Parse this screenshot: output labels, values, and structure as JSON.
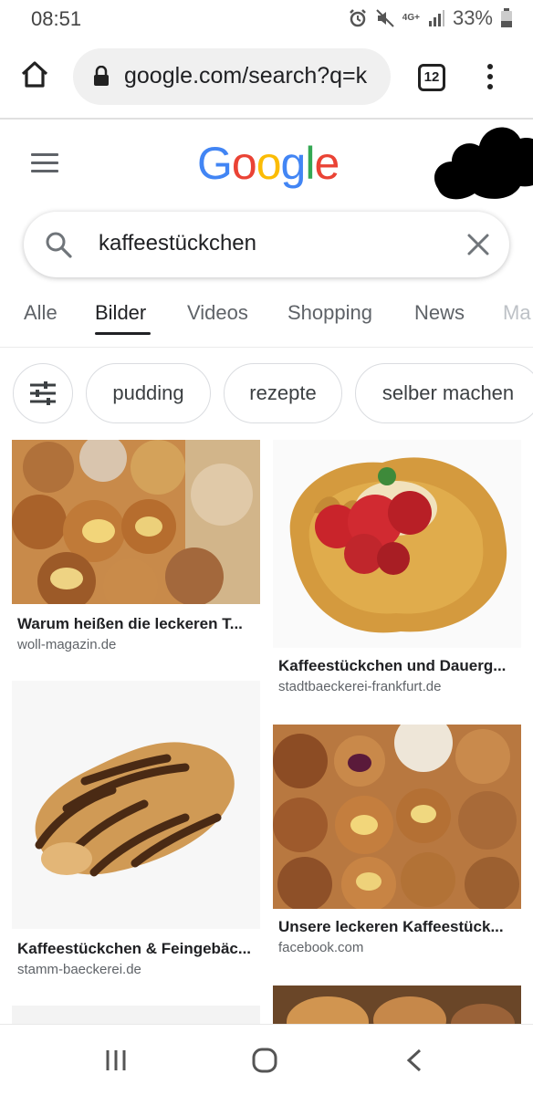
{
  "status_bar": {
    "time": "08:51",
    "network": "4G+",
    "battery": "33%"
  },
  "browser": {
    "url": "google.com/search?q=k",
    "tab_count": "12"
  },
  "search": {
    "query": "kaffeestückchen"
  },
  "tabs": [
    {
      "label": "Alle",
      "active": false
    },
    {
      "label": "Bilder",
      "active": true
    },
    {
      "label": "Videos",
      "active": false
    },
    {
      "label": "Shopping",
      "active": false
    },
    {
      "label": "News",
      "active": false
    },
    {
      "label": "Ma",
      "active": false
    }
  ],
  "chips": [
    "pudding",
    "rezepte",
    "selber machen"
  ],
  "results": [
    {
      "title": "Warum heißen die leckeren T...",
      "source": "woll-magazin.de"
    },
    {
      "title": "Kaffeestückchen und Dauerg...",
      "source": "stadtbaeckerei-frankfurt.de"
    },
    {
      "title": "Kaffeestückchen & Feingebäc...",
      "source": "stamm-baeckerei.de"
    },
    {
      "title": "Unsere leckeren Kaffeestück...",
      "source": "facebook.com"
    }
  ],
  "colors": {
    "google_blue": "#4285f4",
    "google_red": "#ea4335",
    "google_yellow": "#fbbc05",
    "google_green": "#34a853"
  }
}
